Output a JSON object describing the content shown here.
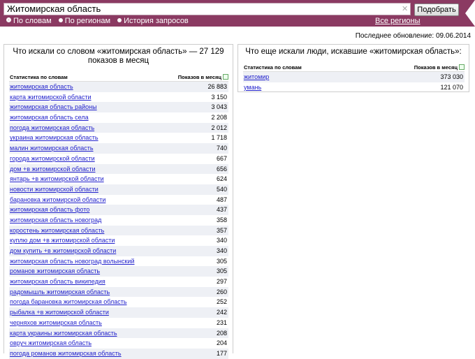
{
  "search": {
    "query": "Житомирская область",
    "submit_label": "Подобрать"
  },
  "modes": [
    {
      "label": "По словам",
      "selected": true
    },
    {
      "label": "По регионам",
      "selected": false
    },
    {
      "label": "История запросов",
      "selected": false
    }
  ],
  "regions_link": "Все регионы",
  "updated": "Последнее обновление: 09.06.2014",
  "left": {
    "title": "Что искали со словом «житомирская область» — 27 129 показов в месяц",
    "col_keyword": "Статистика по словам",
    "col_count": "Показов в месяц",
    "rows": [
      {
        "k": "житомирская область",
        "v": "26 883"
      },
      {
        "k": "карта житомирской области",
        "v": "3 150"
      },
      {
        "k": "житомирская область районы",
        "v": "3 043"
      },
      {
        "k": "житомирская область села",
        "v": "2 208"
      },
      {
        "k": "погода житомирская область",
        "v": "2 012"
      },
      {
        "k": "украина житомирская область",
        "v": "1 718"
      },
      {
        "k": "малин житомирская область",
        "v": "740"
      },
      {
        "k": "города житомирской области",
        "v": "667"
      },
      {
        "k": "дом +в житомирской области",
        "v": "656"
      },
      {
        "k": "янтарь +в житомирской области",
        "v": "624"
      },
      {
        "k": "новости житомирской области",
        "v": "540"
      },
      {
        "k": "барановка житомирской области",
        "v": "487"
      },
      {
        "k": "житомирская область фото",
        "v": "437"
      },
      {
        "k": "житомирская область новоград",
        "v": "358"
      },
      {
        "k": "коростень житомирская область",
        "v": "357"
      },
      {
        "k": "куплю дом +в житомирской области",
        "v": "340"
      },
      {
        "k": "дом купить +в житомирской области",
        "v": "340"
      },
      {
        "k": "житомирская область новоград волынский",
        "v": "305"
      },
      {
        "k": "романов житомирская область",
        "v": "305"
      },
      {
        "k": "житомирская область википедия",
        "v": "297"
      },
      {
        "k": "радомышль житомирская область",
        "v": "260"
      },
      {
        "k": "погода барановка житомирская область",
        "v": "252"
      },
      {
        "k": "рыбалка +в житомирской области",
        "v": "242"
      },
      {
        "k": "черняхов житомирская область",
        "v": "231"
      },
      {
        "k": "карта украины житомирская область",
        "v": "208"
      },
      {
        "k": "овруч житомирская область",
        "v": "204"
      },
      {
        "k": "погода романов житомирская область",
        "v": "177"
      }
    ]
  },
  "right": {
    "title": "Что еще искали люди, искавшие «житомирская область»:",
    "col_keyword": "Статистика по словам",
    "col_count": "Показов в месяц",
    "rows": [
      {
        "k": "житомир",
        "v": "373 030"
      },
      {
        "k": "умань",
        "v": "121 070"
      }
    ]
  }
}
